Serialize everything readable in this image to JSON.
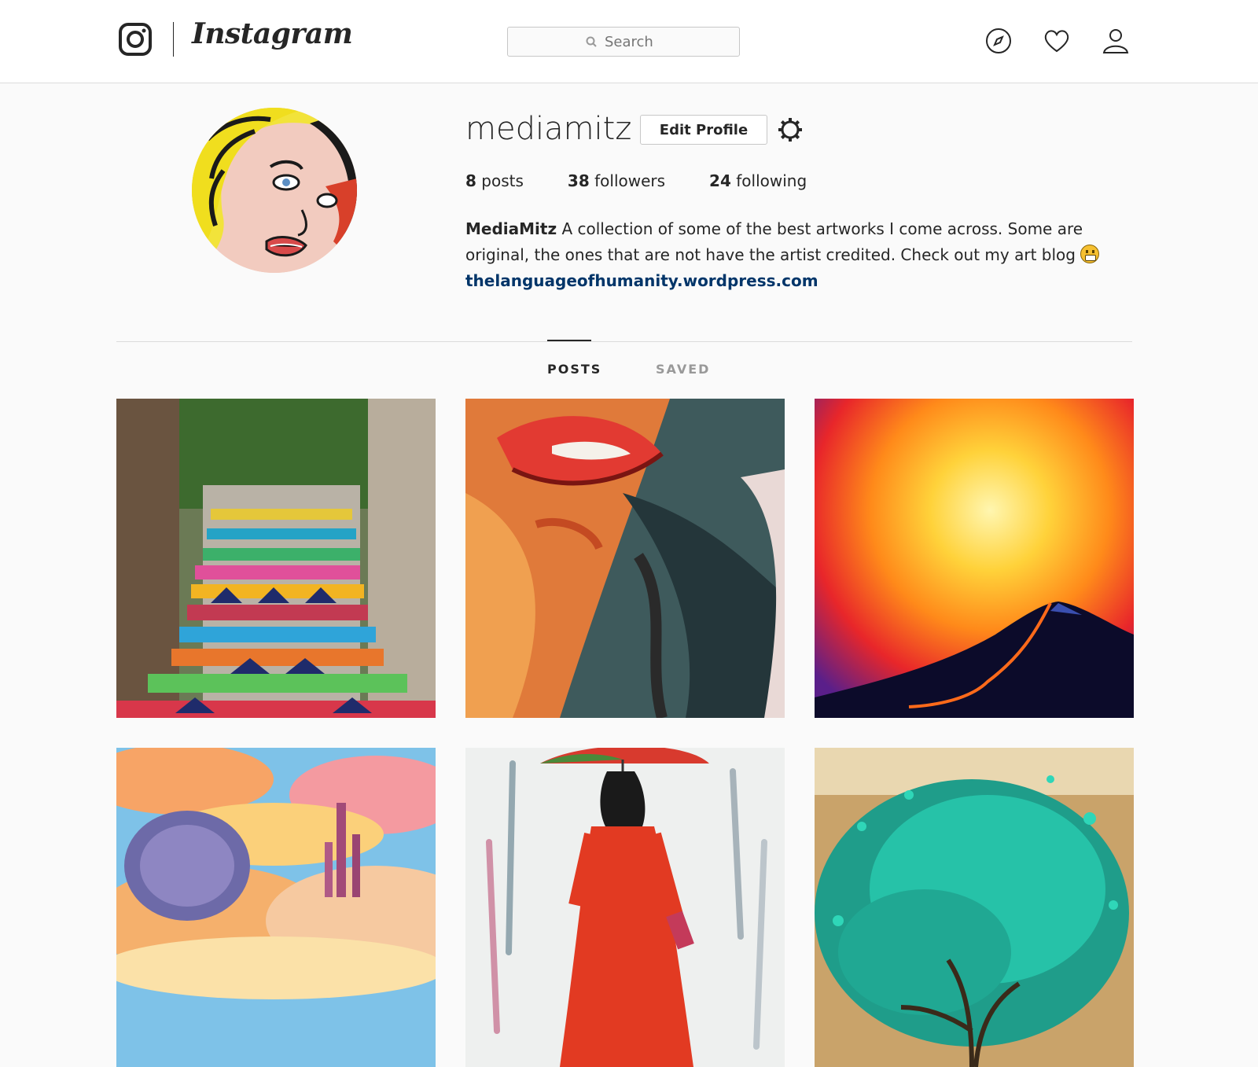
{
  "header": {
    "brand": "Instagram",
    "search_placeholder": "Search",
    "icons": [
      "instagram-glyph-icon",
      "compass-icon",
      "heart-icon",
      "user-icon",
      "search-icon"
    ]
  },
  "profile": {
    "username": "mediamitz",
    "edit_label": "Edit Profile",
    "stats": {
      "posts_count": "8",
      "posts_label": "posts",
      "followers_count": "38",
      "followers_label": "followers",
      "following_count": "24",
      "following_label": "following"
    },
    "bio_name": "MediaMitz",
    "bio_text": "A collection of some of the best artworks I come across. Some are original, the ones that are not have the artist credited. Check out my art blog",
    "website": "thelanguageofhumanity.wordpress.com"
  },
  "tabs": [
    {
      "label": "POSTS",
      "active": true
    },
    {
      "label": "SAVED",
      "active": false
    }
  ],
  "colors": {
    "link": "#003569",
    "border": "#dbdbdb",
    "background": "#fafafa"
  }
}
